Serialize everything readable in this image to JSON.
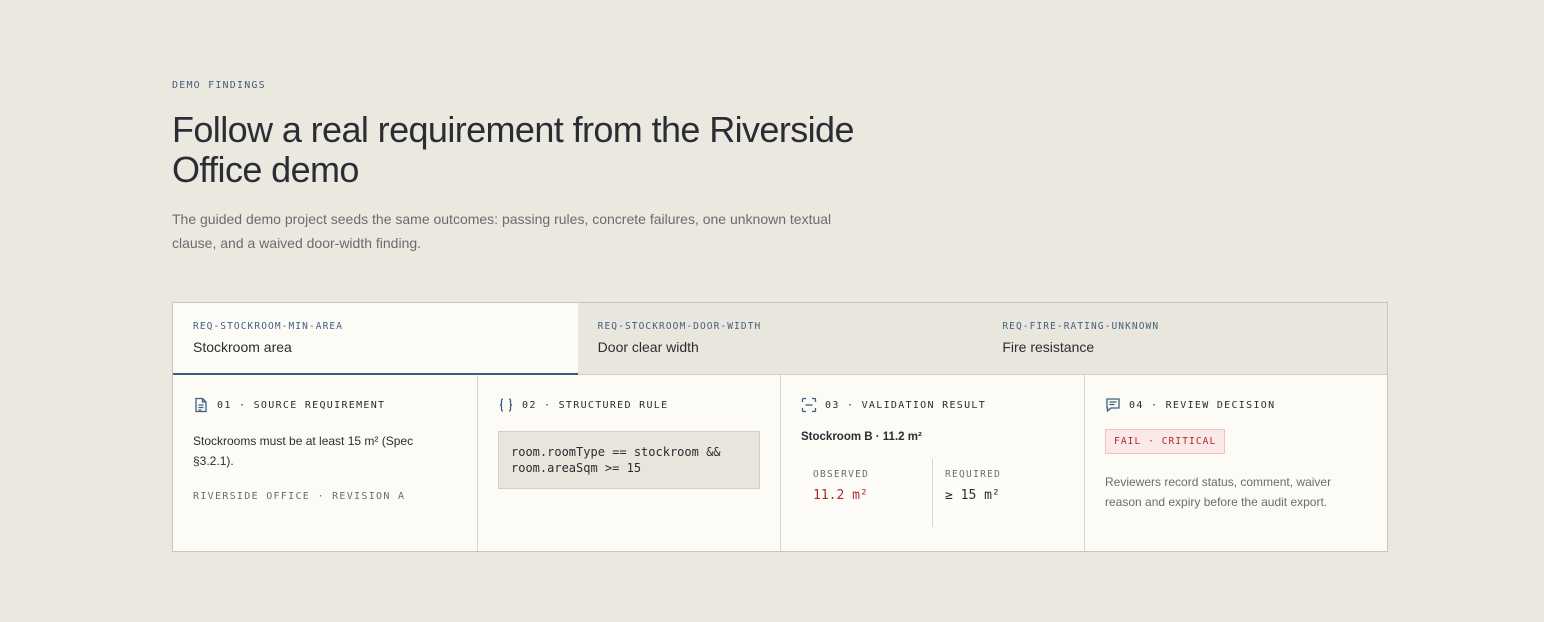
{
  "section": {
    "eyebrow": "DEMO FINDINGS",
    "headline": "Follow a real requirement from the Riverside Office demo",
    "lede": "The guided demo project seeds the same outcomes: passing rules, concrete failures, one unknown textual clause, and a waived door-width finding."
  },
  "tabs": [
    {
      "id": "REQ-STOCKROOM-MIN-AREA",
      "title": "Stockroom area",
      "active": true
    },
    {
      "id": "REQ-STOCKROOM-DOOR-WIDTH",
      "title": "Door clear width",
      "active": false
    },
    {
      "id": "REQ-FIRE-RATING-UNKNOWN",
      "title": "Fire resistance",
      "active": false
    }
  ],
  "steps": {
    "source": {
      "label": "01 · SOURCE REQUIREMENT",
      "icon": "document-icon",
      "text": "Stockrooms must be at least 15 m² (Spec §3.2.1).",
      "meta": "RIVERSIDE OFFICE · REVISION A"
    },
    "rule": {
      "label": "02 · STRUCTURED RULE",
      "icon": "braces-icon",
      "code": "room.roomType == stockroom &&\nroom.areaSqm >= 15"
    },
    "validation": {
      "label": "03 · VALIDATION RESULT",
      "icon": "scan-icon",
      "title": "Stockroom B · 11.2 m²",
      "observed_label": "OBSERVED",
      "observed_value": "11.2 m²",
      "required_label": "REQUIRED",
      "required_value": "≥ 15 m²"
    },
    "review": {
      "label": "04 · REVIEW DECISION",
      "icon": "comment-icon",
      "badge": "FAIL · CRITICAL",
      "text": "Reviewers record status, comment, waiver reason and expiry before the audit export."
    }
  },
  "colors": {
    "background": "#ebe8e0",
    "accent": "#3e5c80",
    "fail": "#b02a2a"
  }
}
